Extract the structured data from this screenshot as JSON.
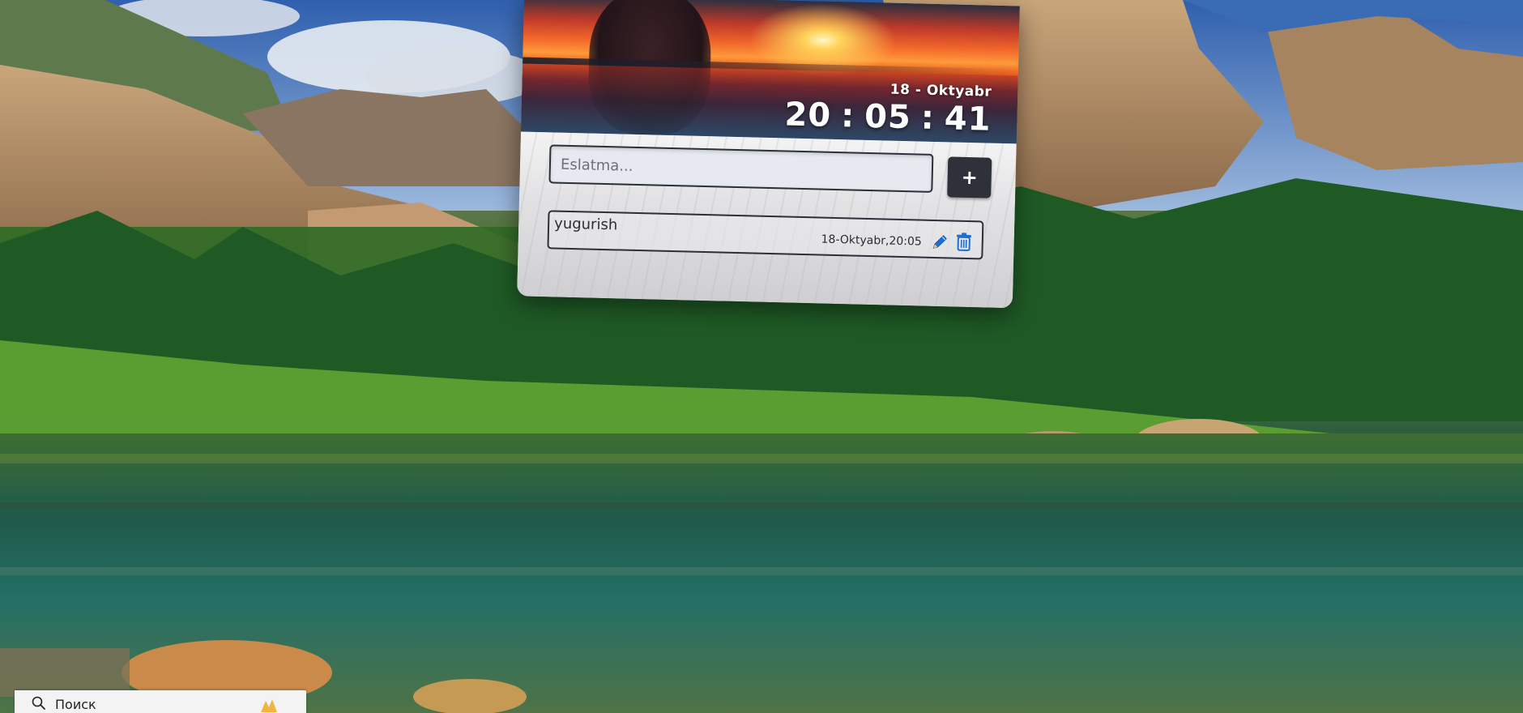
{
  "widget": {
    "date": "18 - Oktyabr",
    "clock": {
      "hours": "20",
      "minutes": "05",
      "seconds": "41",
      "separator": ":"
    },
    "input": {
      "placeholder": "Eslatma...",
      "value": ""
    },
    "add_button_label": "+",
    "tasks": [
      {
        "text": "yugurish",
        "time": "18-Oktyabr,20:05",
        "edit_icon": "pencil-icon",
        "delete_icon": "trash-icon"
      }
    ]
  },
  "taskbar": {
    "search_label": "Поиск",
    "search_icon": "search-icon"
  },
  "colors": {
    "button_dark": "#2e3139",
    "input_bg": "#e6e9ef",
    "border": "#2a2f3a",
    "edit_icon": "#1e6fd0",
    "delete_icon": "#1e6fd0"
  }
}
